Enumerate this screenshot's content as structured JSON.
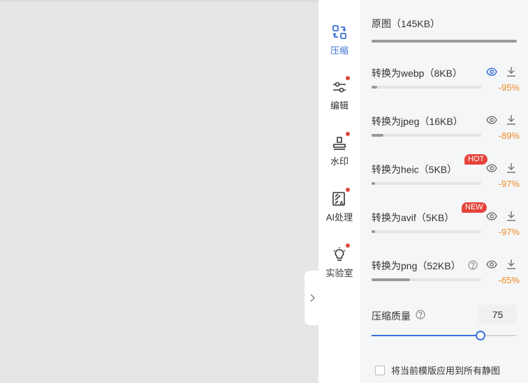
{
  "collapse_icon": "chevron-right-icon",
  "rail": [
    {
      "key": "compress",
      "label": "压缩",
      "icon": "compress-icon",
      "active": true,
      "dot": false
    },
    {
      "key": "edit",
      "label": "编辑",
      "icon": "sliders-icon",
      "active": false,
      "dot": true
    },
    {
      "key": "watermark",
      "label": "水印",
      "icon": "stamp-icon",
      "active": false,
      "dot": true
    },
    {
      "key": "ai",
      "label": "AI处理",
      "icon": "ai-icon",
      "active": false,
      "dot": true
    },
    {
      "key": "lab",
      "label": "实验室",
      "icon": "bulb-icon",
      "active": false,
      "dot": true
    }
  ],
  "original": {
    "label": "原图（145KB）",
    "fill": 1.0
  },
  "formats": [
    {
      "key": "webp",
      "label": "转换为webp（8KB）",
      "percent": "-95%",
      "fill": 0.05,
      "badge": "",
      "eye_active": true,
      "help": false
    },
    {
      "key": "jpeg",
      "label": "转换为jpeg（16KB）",
      "percent": "-89%",
      "fill": 0.11,
      "badge": "",
      "eye_active": false,
      "help": false
    },
    {
      "key": "heic",
      "label": "转换为heic（5KB）",
      "percent": "-97%",
      "fill": 0.03,
      "badge": "HOT",
      "eye_active": false,
      "help": false
    },
    {
      "key": "avif",
      "label": "转换为avif（5KB）",
      "percent": "-97%",
      "fill": 0.03,
      "badge": "NEW",
      "eye_active": false,
      "help": false
    },
    {
      "key": "png",
      "label": "转换为png（52KB）",
      "percent": "-65%",
      "fill": 0.35,
      "badge": "",
      "eye_active": false,
      "help": true
    }
  ],
  "quality": {
    "label": "压缩质量",
    "value": "75",
    "level": 0.75
  },
  "apply_all": {
    "label": "将当前模版应用到所有静图",
    "checked": false
  },
  "colors": {
    "accent": "#3b6fd8",
    "saving": "#f08a24",
    "badge": "#e5453b",
    "dot": "#e0463c"
  }
}
